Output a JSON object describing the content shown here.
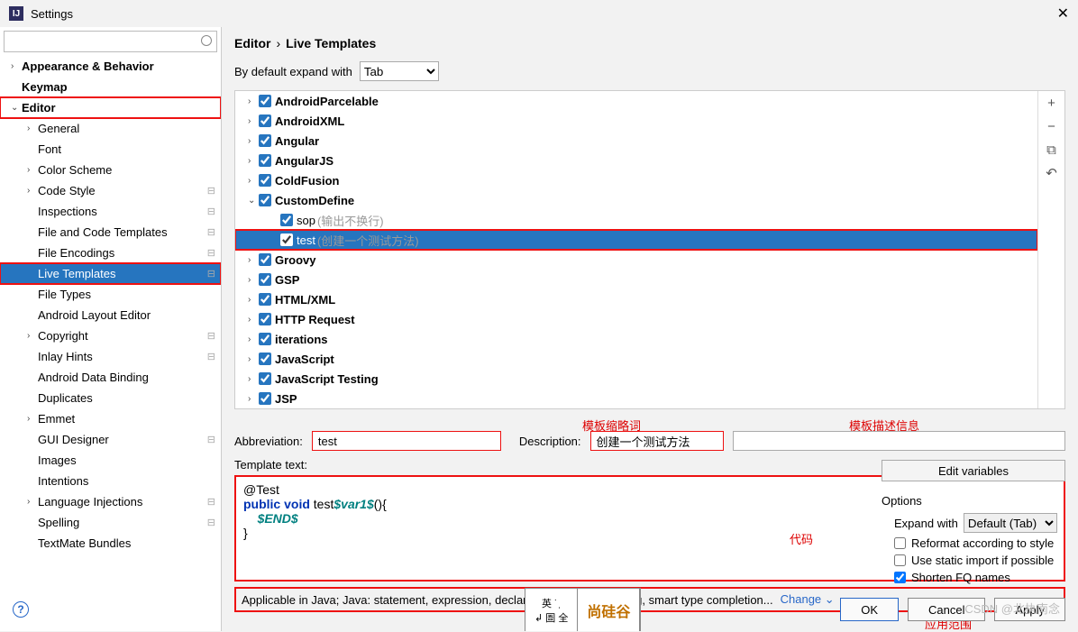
{
  "window": {
    "title": "Settings",
    "close_glyph": "✕"
  },
  "search": {
    "placeholder": ""
  },
  "sidebar": {
    "items": [
      {
        "label": "Appearance & Behavior",
        "arrow": "›",
        "lvl": 1,
        "bold": true
      },
      {
        "label": "Keymap",
        "arrow": "",
        "lvl": 1,
        "bold": true
      },
      {
        "label": "Editor",
        "arrow": "⌄",
        "lvl": 1,
        "bold": true,
        "boxed": true
      },
      {
        "label": "General",
        "arrow": "›",
        "lvl": 2
      },
      {
        "label": "Font",
        "arrow": "",
        "lvl": 2
      },
      {
        "label": "Color Scheme",
        "arrow": "›",
        "lvl": 2
      },
      {
        "label": "Code Style",
        "arrow": "›",
        "lvl": 2,
        "pin": true
      },
      {
        "label": "Inspections",
        "arrow": "",
        "lvl": 2,
        "pin": true
      },
      {
        "label": "File and Code Templates",
        "arrow": "",
        "lvl": 2,
        "pin": true
      },
      {
        "label": "File Encodings",
        "arrow": "",
        "lvl": 2,
        "pin": true
      },
      {
        "label": "Live Templates",
        "arrow": "",
        "lvl": 2,
        "pin": true,
        "selected": true,
        "boxed": true
      },
      {
        "label": "File Types",
        "arrow": "",
        "lvl": 2
      },
      {
        "label": "Android Layout Editor",
        "arrow": "",
        "lvl": 2
      },
      {
        "label": "Copyright",
        "arrow": "›",
        "lvl": 2,
        "pin": true
      },
      {
        "label": "Inlay Hints",
        "arrow": "",
        "lvl": 2,
        "pin": true
      },
      {
        "label": "Android Data Binding",
        "arrow": "",
        "lvl": 2
      },
      {
        "label": "Duplicates",
        "arrow": "",
        "lvl": 2
      },
      {
        "label": "Emmet",
        "arrow": "›",
        "lvl": 2
      },
      {
        "label": "GUI Designer",
        "arrow": "",
        "lvl": 2,
        "pin": true
      },
      {
        "label": "Images",
        "arrow": "",
        "lvl": 2
      },
      {
        "label": "Intentions",
        "arrow": "",
        "lvl": 2
      },
      {
        "label": "Language Injections",
        "arrow": "›",
        "lvl": 2,
        "pin": true
      },
      {
        "label": "Spelling",
        "arrow": "",
        "lvl": 2,
        "pin": true
      },
      {
        "label": "TextMate Bundles",
        "arrow": "",
        "lvl": 2
      }
    ]
  },
  "breadcrumb": {
    "root": "Editor",
    "sep": "›",
    "leaf": "Live Templates"
  },
  "expand": {
    "label": "By default expand with",
    "value": "Tab"
  },
  "templates": {
    "items": [
      {
        "label": "AndroidParcelable",
        "arrow": "›",
        "bold": true
      },
      {
        "label": "AndroidXML",
        "arrow": "›",
        "bold": true
      },
      {
        "label": "Angular",
        "arrow": "›",
        "bold": true
      },
      {
        "label": "AngularJS",
        "arrow": "›",
        "bold": true
      },
      {
        "label": "ColdFusion",
        "arrow": "›",
        "bold": true
      },
      {
        "label": "CustomDefine",
        "arrow": "⌄",
        "bold": true
      },
      {
        "label": "sop",
        "hint": "(输出不换行)",
        "lvl": 2
      },
      {
        "label": "test",
        "hint": "(创建一个测试方法)",
        "lvl": 2,
        "selected": true,
        "boxed": true
      },
      {
        "label": "Groovy",
        "arrow": "›",
        "bold": true
      },
      {
        "label": "GSP",
        "arrow": "›",
        "bold": true
      },
      {
        "label": "HTML/XML",
        "arrow": "›",
        "bold": true
      },
      {
        "label": "HTTP Request",
        "arrow": "›",
        "bold": true
      },
      {
        "label": "iterations",
        "arrow": "›",
        "bold": true
      },
      {
        "label": "JavaScript",
        "arrow": "›",
        "bold": true
      },
      {
        "label": "JavaScript Testing",
        "arrow": "›",
        "bold": true
      },
      {
        "label": "JSP",
        "arrow": "›",
        "bold": true
      }
    ],
    "side_btns": [
      "+",
      "−",
      "⧉",
      "↶"
    ]
  },
  "annotations": {
    "abbrev": "模板缩略词",
    "desc": "模板描述信息",
    "code": "代码",
    "scope": "应用范围"
  },
  "form": {
    "abbrev_label": "Abbreviation:",
    "abbrev_value": "test",
    "desc_label": "Description:",
    "desc_value": "创建一个测试方法",
    "tpl_label": "Template text:",
    "code_lines": {
      "l1": "@Test",
      "l2a": "public",
      "l2b": "void",
      "l2c": "test",
      "l2v": "$var1$",
      "l2d": "(){",
      "l3": "$END$",
      "l4": "}"
    }
  },
  "options": {
    "edit_btn": "Edit variables",
    "header": "Options",
    "expand_label": "Expand with",
    "expand_value": "Default (Tab)",
    "cb1": "Reformat according to style",
    "cb2": "Use static import if possible",
    "cb3": "Shorten FQ names"
  },
  "applicable": {
    "text": "Applicable in Java; Java: statement, expression, declaration, comment, string, smart type completion...",
    "change": "Change ⌄"
  },
  "footer": {
    "ok": "OK",
    "cancel": "Cancel",
    "apply": "Apply"
  },
  "watermark": "CSDN @北执南念",
  "logo": {
    "cell1a": "英 ˙ˌ",
    "cell1b": "↲ 圄 全",
    "cell2": "尚硅谷"
  }
}
